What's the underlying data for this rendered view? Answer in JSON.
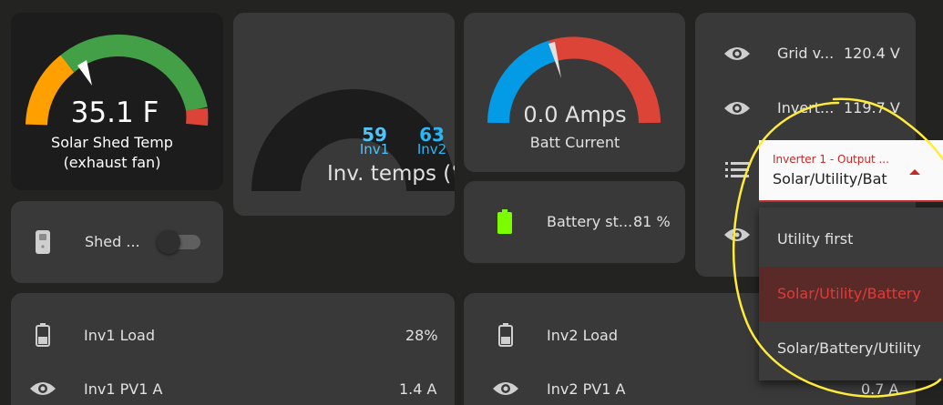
{
  "solar_shed_gauge": {
    "value": "35.1 F",
    "name_line1": "Solar Shed Temp",
    "name_line2": "(exhaust fan)",
    "level": 0.34
  },
  "inv_temps_gauge": {
    "title": "Inv. temps (°F)",
    "inv1_value": "59",
    "inv1_label": "Inv1",
    "inv2_value": "63",
    "inv2_label": "Inv2"
  },
  "batt_current_gauge": {
    "value": "0.0 Amps",
    "name": "Batt Current",
    "level": 0.47
  },
  "battery_state": {
    "label": "Battery st...",
    "value": "81 %"
  },
  "shed_fan": {
    "label": "Shed ...",
    "on": false
  },
  "right_panel": {
    "grid_voltage": {
      "label": "Grid v...",
      "value": "120.4 V"
    },
    "inverter_voltage": {
      "label": "Invert...",
      "value": "119.7 V"
    }
  },
  "output_select": {
    "label": "Inverter 1 - Output ...",
    "selected": "Solar/Utility/Bat",
    "options": [
      "Utility first",
      "Solar/Utility/Battery",
      "Solar/Battery/Utility"
    ],
    "highlighted_index": 1
  },
  "inv1": {
    "load_label": "Inv1 Load",
    "load_value": "28%",
    "pv1_label": "Inv1 PV1 A",
    "pv1_value": "1.4 A"
  },
  "inv2": {
    "load_label": "Inv2 Load",
    "pv1_label": "Inv2 PV1 A",
    "pv1_value": "0.7 A"
  },
  "colors": {
    "accent": "#c62828",
    "green": "#43a047",
    "orange": "#ffa000",
    "red": "#db4437",
    "blue": "#039be5",
    "annotation": "#ffeb3b"
  }
}
